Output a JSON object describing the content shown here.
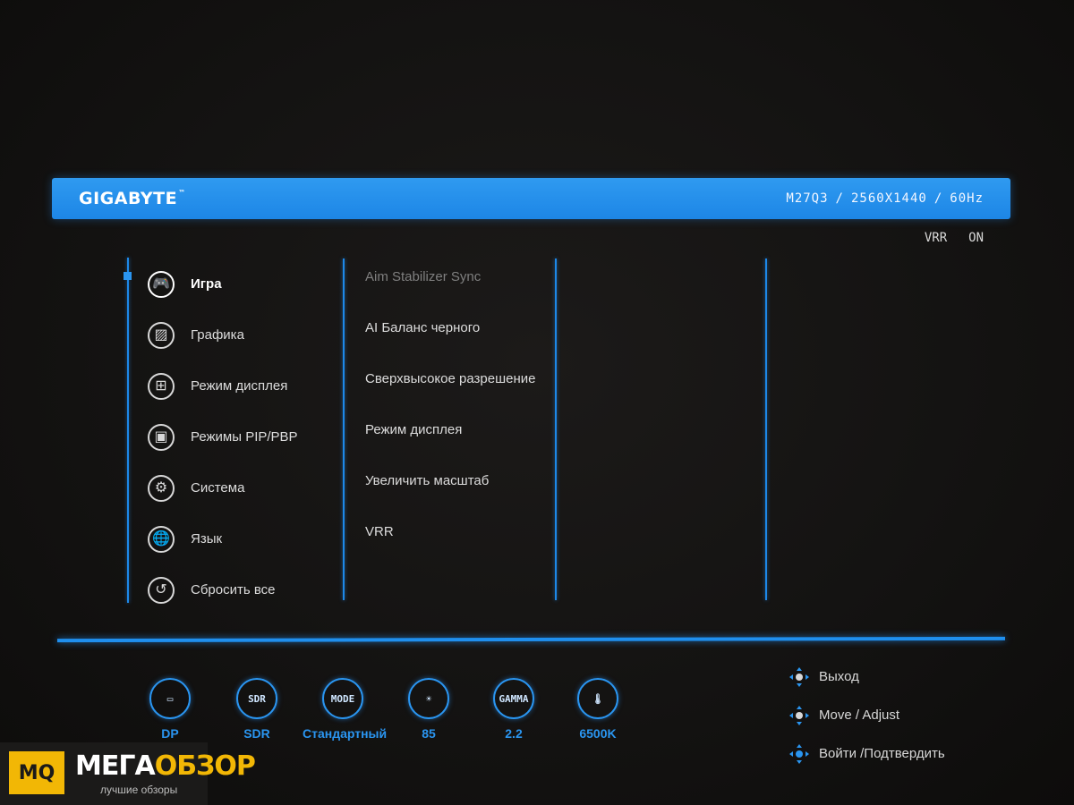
{
  "header": {
    "brand": "GIGABYTE",
    "trademark": "™",
    "model": "M27Q3",
    "resolution": "2560X1440",
    "refresh": "60Hz",
    "separator": "/"
  },
  "status_top": {
    "label": "VRR",
    "value": "ON"
  },
  "main_menu": {
    "items": [
      {
        "label": "Игра",
        "icon": "gamepad-icon",
        "glyph": "🎮",
        "active": true
      },
      {
        "label": "Графика",
        "icon": "picture-icon",
        "glyph": "▨"
      },
      {
        "label": "Режим дисплея",
        "icon": "grid-icon",
        "glyph": "⊞"
      },
      {
        "label": "Режимы PIP/PBP",
        "icon": "pip-icon",
        "glyph": "▣"
      },
      {
        "label": "Система",
        "icon": "gear-icon",
        "glyph": "⚙"
      },
      {
        "label": "Язык",
        "icon": "globe-icon",
        "glyph": "🌐"
      },
      {
        "label": "Сбросить все",
        "icon": "reset-icon",
        "glyph": "↺"
      }
    ]
  },
  "sub_menu": {
    "items": [
      {
        "label": "Aim Stabilizer Sync",
        "disabled": true
      },
      {
        "label": "AI Баланс черного"
      },
      {
        "label": "Сверхвысокое разрешение"
      },
      {
        "label": "Режим дисплея"
      },
      {
        "label": "Увеличить масштаб"
      },
      {
        "label": "VRR"
      }
    ]
  },
  "status_bar": [
    {
      "icon": "input-port-icon",
      "badge": "▭",
      "value": "DP"
    },
    {
      "icon": "sdr-icon",
      "badge": "SDR",
      "value": "SDR"
    },
    {
      "icon": "mode-icon",
      "badge": "MODE",
      "value": "Стандартный"
    },
    {
      "icon": "brightness-icon",
      "badge": "☀",
      "value": "85"
    },
    {
      "icon": "gamma-icon",
      "badge": "GAMMA",
      "value": "2.2"
    },
    {
      "icon": "temperature-icon",
      "badge": "🌡",
      "value": "6500K"
    }
  ],
  "hints": [
    {
      "label": "Выход",
      "icon": "dpad-exit-icon"
    },
    {
      "label": "Move / Adjust",
      "icon": "dpad-move-icon"
    },
    {
      "label": "Войти /Подтвердить",
      "icon": "dpad-enter-icon"
    }
  ],
  "watermark": {
    "logo": "MQ",
    "title_a": "МЕГА",
    "title_b": "ОБЗОР",
    "subtitle": "лучшие обзоры"
  },
  "colors": {
    "accent": "#1d86e6",
    "background": "#141312",
    "watermark_yellow": "#f2b705"
  }
}
